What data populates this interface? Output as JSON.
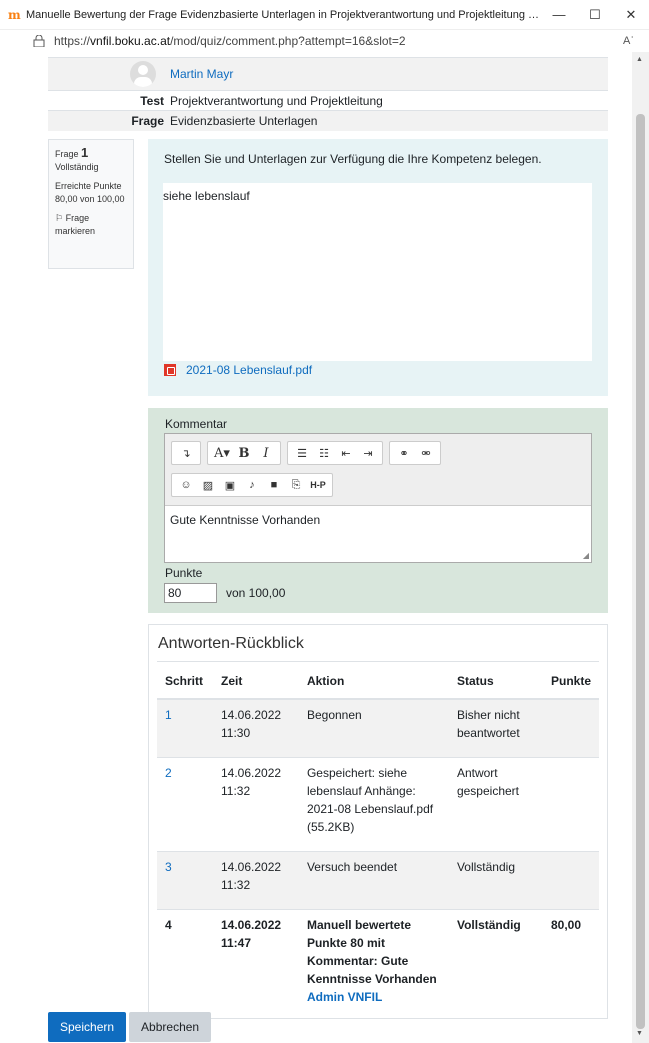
{
  "window": {
    "title": "Manuelle Bewertung der Frage Evidenzbasierte Unterlagen in Projektverantwortung und Projektleitung für Martin Ma...",
    "min": "—",
    "max": "☐",
    "close": "✕"
  },
  "address": {
    "prefix": "https://",
    "host": "vnfil.boku.ac.at",
    "path": "/mod/quiz/comment.php?attempt=16&slot=2",
    "read_icon": "Aʾ"
  },
  "info": {
    "user": "Martin Mayr",
    "test_label": "Test",
    "test_value": "Projektverantwortung und Projektleitung",
    "frage_label": "Frage",
    "frage_value": "Evidenzbasierte Unterlagen"
  },
  "qinfo": {
    "frage_label": "Frage",
    "frage_no": "1",
    "state": "Vollständig",
    "grade_label": "Erreichte Punkte",
    "grade_value": "80,00 von 100,00",
    "flag_label": "Frage markieren"
  },
  "question": {
    "text": "Stellen Sie und Unterlagen zur Verfügung die Ihre Kompetenz belegen.",
    "answer": "siehe lebenslauf",
    "attachment": "2021-08 Lebenslauf.pdf"
  },
  "comment": {
    "label": "Kommentar",
    "text": "Gute Kenntnisse Vorhanden",
    "points_label": "Punkte",
    "points_value": "80",
    "points_of": "von 100,00"
  },
  "history": {
    "title": "Antworten-Rückblick",
    "headers": [
      "Schritt",
      "Zeit",
      "Aktion",
      "Status",
      "Punkte"
    ],
    "rows": [
      {
        "step": "1",
        "time": "14.06.2022 11:30",
        "action": "Begonnen",
        "status": "Bisher nicht beantwortet",
        "points": ""
      },
      {
        "step": "2",
        "time": "14.06.2022 11:32",
        "action": "Gespeichert: siehe lebenslauf Anhänge: 2021-08 Lebenslauf.pdf (55.2KB)",
        "status": "Antwort gespeichert",
        "points": ""
      },
      {
        "step": "3",
        "time": "14.06.2022 11:32",
        "action": "Versuch beendet",
        "status": "Vollständig",
        "points": ""
      },
      {
        "step": "4",
        "time": "14.06.2022 11:47",
        "action": "Manuell bewertete Punkte 80 mit Kommentar: Gute Kenntnisse Vorhanden",
        "action_user": "Admin VNFIL",
        "status": "Vollständig",
        "points": "80,00"
      }
    ]
  },
  "buttons": {
    "save": "Speichern",
    "cancel": "Abbrechen"
  },
  "colors": {
    "primary": "#0f6cbf",
    "formulation_bg": "#e7f3f5",
    "comment_bg": "#d8e6dc",
    "pdf_red": "#e03628"
  }
}
